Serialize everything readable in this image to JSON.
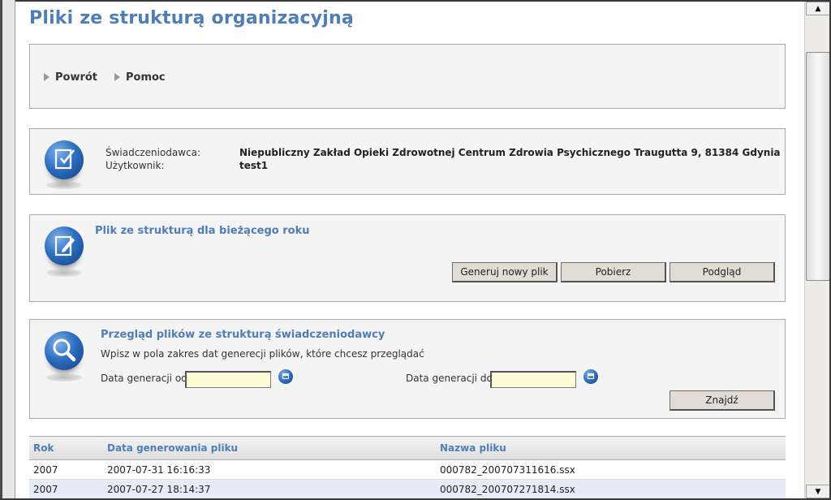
{
  "page": {
    "title": "Pliki ze strukturą organizacyjną"
  },
  "nav": {
    "back_label": "Powrót",
    "help_label": "Pomoc"
  },
  "info": {
    "provider_label": "Świadczeniodawca:",
    "provider_value": "Niepubliczny Zakład Opieki Zdrowotnej Centrum Zdrowia Psychicznego Traugutta 9, 81384 Gdynia",
    "user_label": "Użytkownik:",
    "user_value": "test1"
  },
  "current_year": {
    "title": "Plik ze strukturą dla bieżącego roku",
    "generate_label": "Generuj nowy plik",
    "download_label": "Pobierz",
    "preview_label": "Podgląd"
  },
  "search": {
    "title": "Przegląd plików ze strukturą świadczeniodawcy",
    "hint": "Wpisz w pola zakres dat generecji plików, które chcesz przeglądać",
    "date_from_label": "Data generacji od:",
    "date_from_value": "",
    "date_to_label": "Data generacji do:",
    "date_to_value": "",
    "find_label": "Znajdź"
  },
  "results": {
    "headers": {
      "year": "Rok",
      "date": "Data generowania pliku",
      "name": "Nazwa pliku"
    },
    "rows": [
      {
        "year": "2007",
        "date": "2007-07-31 16:16:33",
        "name": "000782_200707311616.ssx"
      },
      {
        "year": "2007",
        "date": "2007-07-27 18:14:37",
        "name": "000782_200707271814.ssx"
      }
    ]
  },
  "colors": {
    "accent": "#4f7db5",
    "panel": "#f4f4f4",
    "input": "#fffbd6"
  },
  "icons": {
    "info_icon": "edit-check-icon",
    "current_year_icon": "edit-pencil-icon",
    "search_icon": "magnifier-icon",
    "calendar_icon": "calendar-icon"
  }
}
